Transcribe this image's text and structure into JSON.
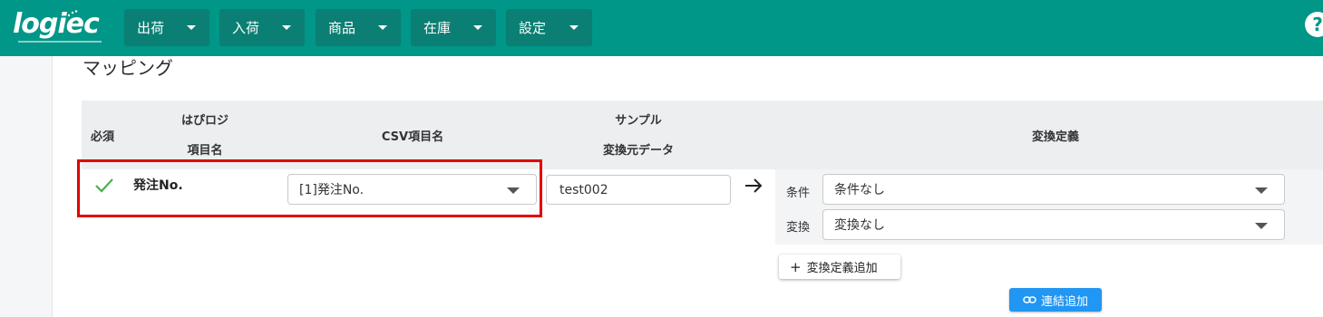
{
  "app": {
    "logo_text": "logiec",
    "help_icon": "?"
  },
  "nav": {
    "items": [
      {
        "label": "出荷"
      },
      {
        "label": "入荷"
      },
      {
        "label": "商品"
      },
      {
        "label": "在庫"
      },
      {
        "label": "設定"
      }
    ]
  },
  "page": {
    "title": "マッピング"
  },
  "table": {
    "headers": {
      "required": "必須",
      "habi_line1": "はぴロジ",
      "habi_line2": "項目名",
      "csv": "CSV項目名",
      "sample_line1": "サンプル",
      "sample_line2": "変換元データ",
      "conversion": "変換定義"
    },
    "row": {
      "required_icon": "check-icon",
      "item_name": "発注No.",
      "csv_selected": "[1]発注No.",
      "sample_value": "test002",
      "conditions": [
        {
          "label": "条件",
          "value": "条件なし"
        },
        {
          "label": "変換",
          "value": "変換なし"
        }
      ],
      "add_definition_label": "変換定義追加",
      "add_definition_icon": "+"
    }
  },
  "footer": {
    "add_link_label": "連結追加"
  },
  "colors": {
    "header_bg": "#009688",
    "nav_button_bg": "#0b7f73",
    "highlight_border": "#e10000",
    "primary_button": "#2196f3",
    "check": "#4caf50"
  }
}
